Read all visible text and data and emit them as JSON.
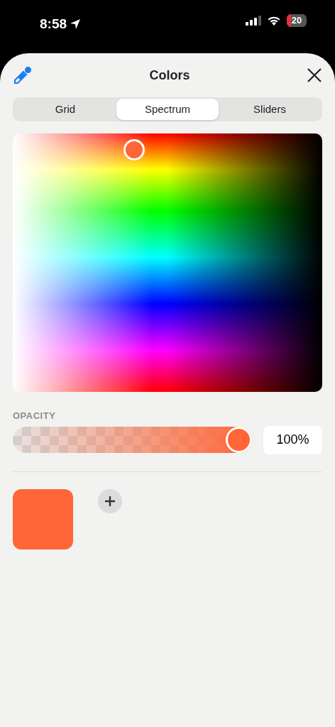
{
  "status_bar": {
    "time": "8:58",
    "battery": "20"
  },
  "sheet": {
    "title": "Colors"
  },
  "tabs": [
    {
      "label": "Grid",
      "selected": false
    },
    {
      "label": "Spectrum",
      "selected": true
    },
    {
      "label": "Sliders",
      "selected": false
    }
  ],
  "opacity": {
    "label": "OPACITY",
    "level": 1,
    "value": "100%"
  },
  "swatches": [
    {
      "color": "#ff6536"
    }
  ]
}
